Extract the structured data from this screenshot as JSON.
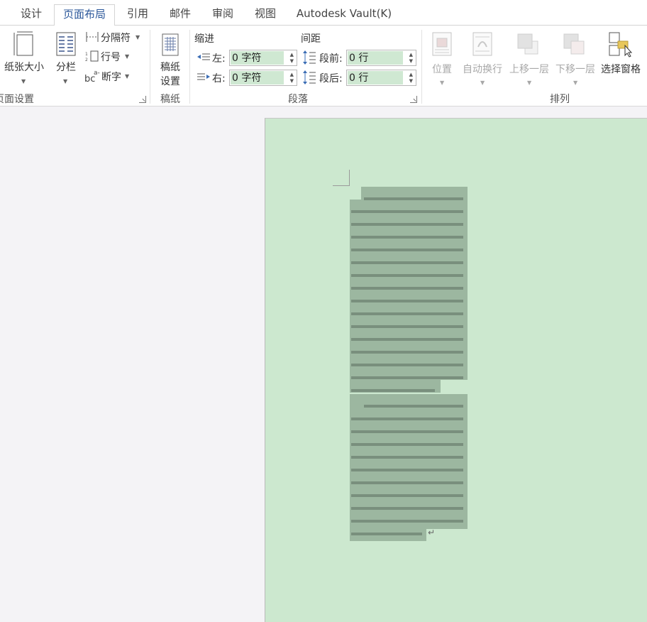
{
  "tabs": [
    "设计",
    "页面布局",
    "引用",
    "邮件",
    "审阅",
    "视图",
    "Autodesk Vault(K)"
  ],
  "page_setup": {
    "paper_size": "纸张大小",
    "columns": "分栏",
    "breaks": "分隔符",
    "line_numbers": "行号",
    "hyphenation": "断字",
    "group_label": "页面设置"
  },
  "manuscript": {
    "button": "稿纸设置",
    "line1": "稿纸",
    "line2": "设置",
    "group_label": "稿纸"
  },
  "paragraph": {
    "indent_header": "缩进",
    "spacing_header": "间距",
    "left_label": "左:",
    "right_label": "右:",
    "left_value": "0 字符",
    "right_value": "0 字符",
    "before_label": "段前:",
    "after_label": "段后:",
    "before_value": "0 行",
    "after_value": "0 行",
    "group_label": "段落"
  },
  "arrange": {
    "position": "位置",
    "wrap_text": "自动换行",
    "bring_forward": "上移一层",
    "send_backward": "下移一层",
    "selection_pane": "选择窗格",
    "group_label": "排列"
  },
  "document": {
    "selection_color": "#9cb7a0",
    "page_color": "#cce8cf"
  }
}
